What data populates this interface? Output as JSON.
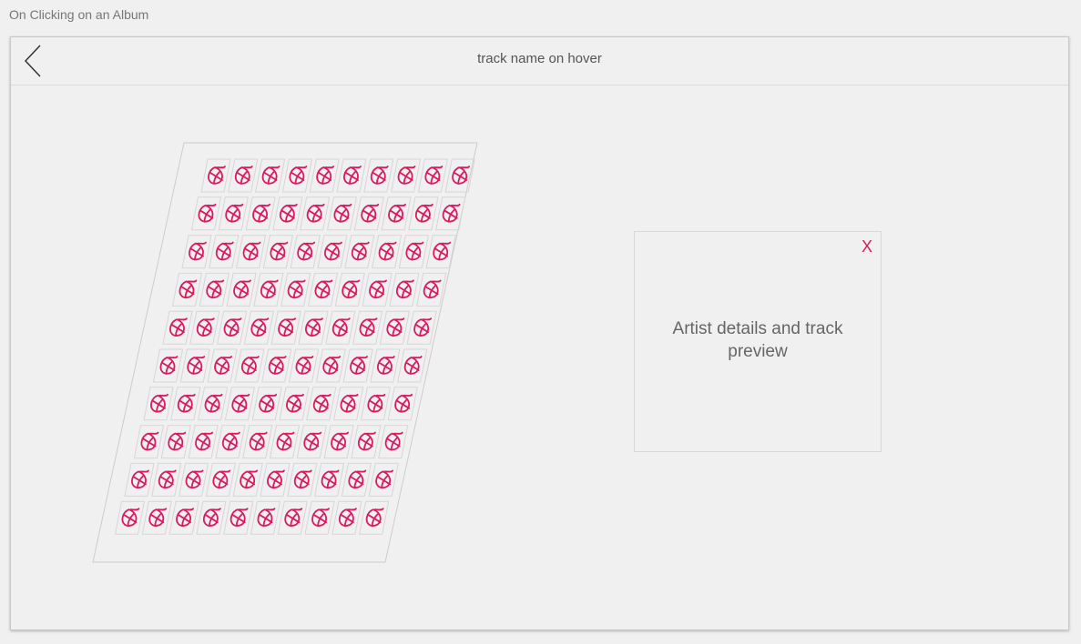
{
  "page": {
    "caption": "On Clicking on an Album"
  },
  "header": {
    "back_icon": "chevron-left-icon",
    "title": "track name on hover"
  },
  "track_grid": {
    "rows": 10,
    "columns": 10,
    "tile_icon": "album-flame-logo-icon",
    "accent_color": "#d81b60"
  },
  "detail_panel": {
    "close_label": "X",
    "text": "Artist details and track preview"
  }
}
